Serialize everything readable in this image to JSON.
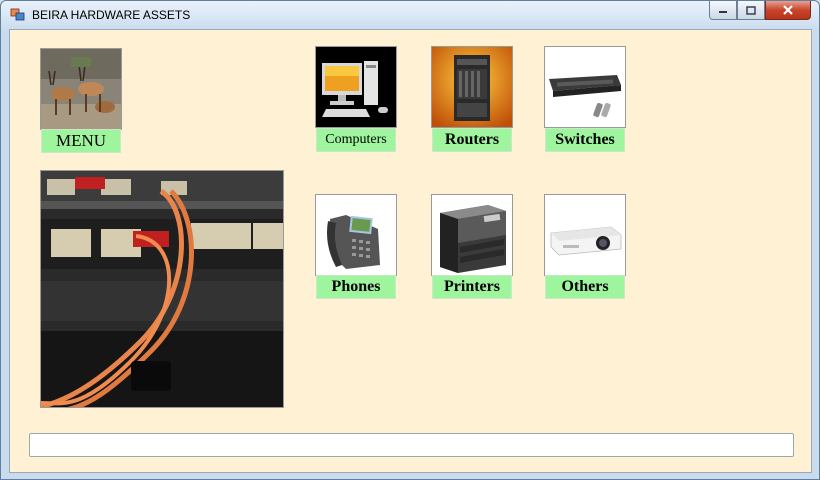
{
  "window": {
    "title": "BEIRA HARDWARE ASSETS"
  },
  "controls": {
    "minimize": "",
    "maximize": "",
    "close": ""
  },
  "menu": {
    "label": "MENU"
  },
  "categories": [
    {
      "label": "Computers"
    },
    {
      "label": "Routers"
    },
    {
      "label": "Switches"
    },
    {
      "label": "Phones"
    },
    {
      "label": "Printers"
    },
    {
      "label": "Others"
    }
  ],
  "status_input": {
    "value": ""
  }
}
